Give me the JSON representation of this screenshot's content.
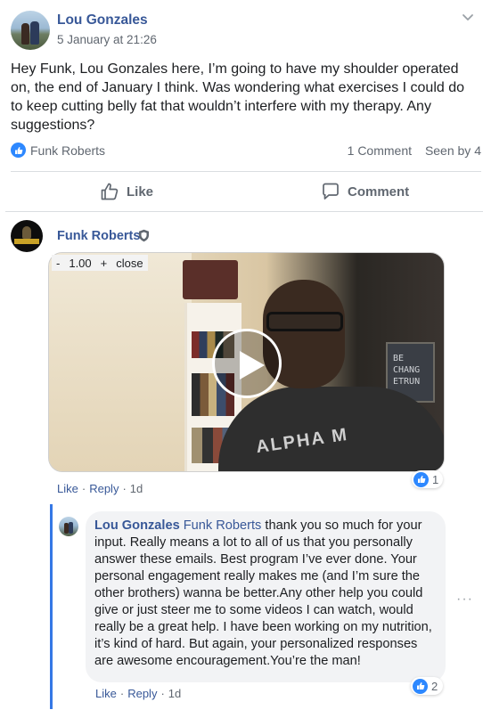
{
  "post": {
    "author": "Lou Gonzales",
    "time": "5 January at 21:26",
    "text": "Hey Funk, Lou Gonzales here, I’m going to have my shoulder operated on, the end of January I think. Was wondering what exercises I could do to keep cutting belly fat that wouldn’t interfere with my therapy. Any suggestions?",
    "reaction_name": "Funk Roberts",
    "comments_count": "1 Comment",
    "seen_by": "Seen by 4",
    "like_label": "Like",
    "comment_label": "Comment"
  },
  "comment": {
    "author": "Funk Roberts",
    "zoom": {
      "minus": "-",
      "value": "1.00",
      "plus": "+",
      "close": "close"
    },
    "video_reaction_count": "1",
    "like": "Like",
    "reply": "Reply",
    "age": "1d",
    "sep": "·"
  },
  "reply": {
    "author": "Lou Gonzales",
    "mention": "Funk Roberts",
    "text": "thank you so much for your input. Really means a lot to all of us that you personally answer these emails. Best program I’ve ever done. Your personal engagement really makes me (and I’m sure the other brothers) wanna be better.Any other help you could give or just steer me to some videos I can watch, would really be a great help. I have been working on my nutrition, it’s kind of hard. But again, your personalized responses are awesome encouragement.You’re the man!",
    "reaction_count": "2",
    "like": "Like",
    "reply": "Reply",
    "age": "1d",
    "sep": "·",
    "more": "···"
  },
  "video_overlay": {
    "shirt_text": "ALPHA M",
    "board_text": "BE CHANG ETRUN"
  },
  "colors": {
    "link": "#385898",
    "accent": "#2d88ff",
    "thread": "#3578e5",
    "muted": "#606770"
  },
  "icons": [
    "chevron-down-icon",
    "like-badge-icon",
    "thumbs-up-icon",
    "comment-icon",
    "shield-icon",
    "play-icon"
  ]
}
